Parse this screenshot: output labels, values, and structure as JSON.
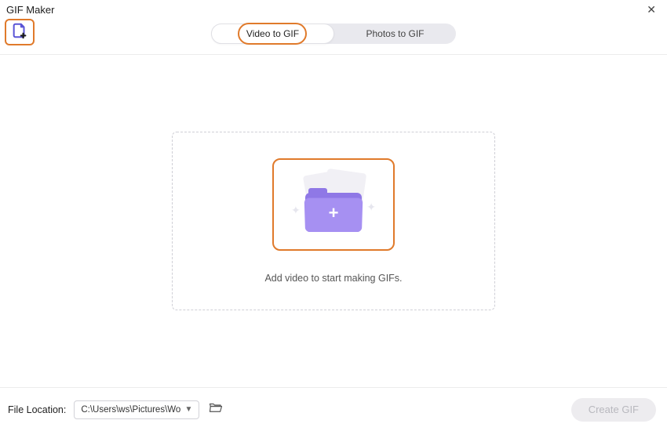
{
  "window": {
    "title": "GIF Maker"
  },
  "tabs": {
    "video": "Video to GIF",
    "photos": "Photos to GIF",
    "active": "video"
  },
  "dropzone": {
    "hint": "Add video to start making GIFs."
  },
  "footer": {
    "path_label": "File Location:",
    "path_value": "C:\\Users\\ws\\Pictures\\Wonders",
    "create_label": "Create GIF"
  }
}
